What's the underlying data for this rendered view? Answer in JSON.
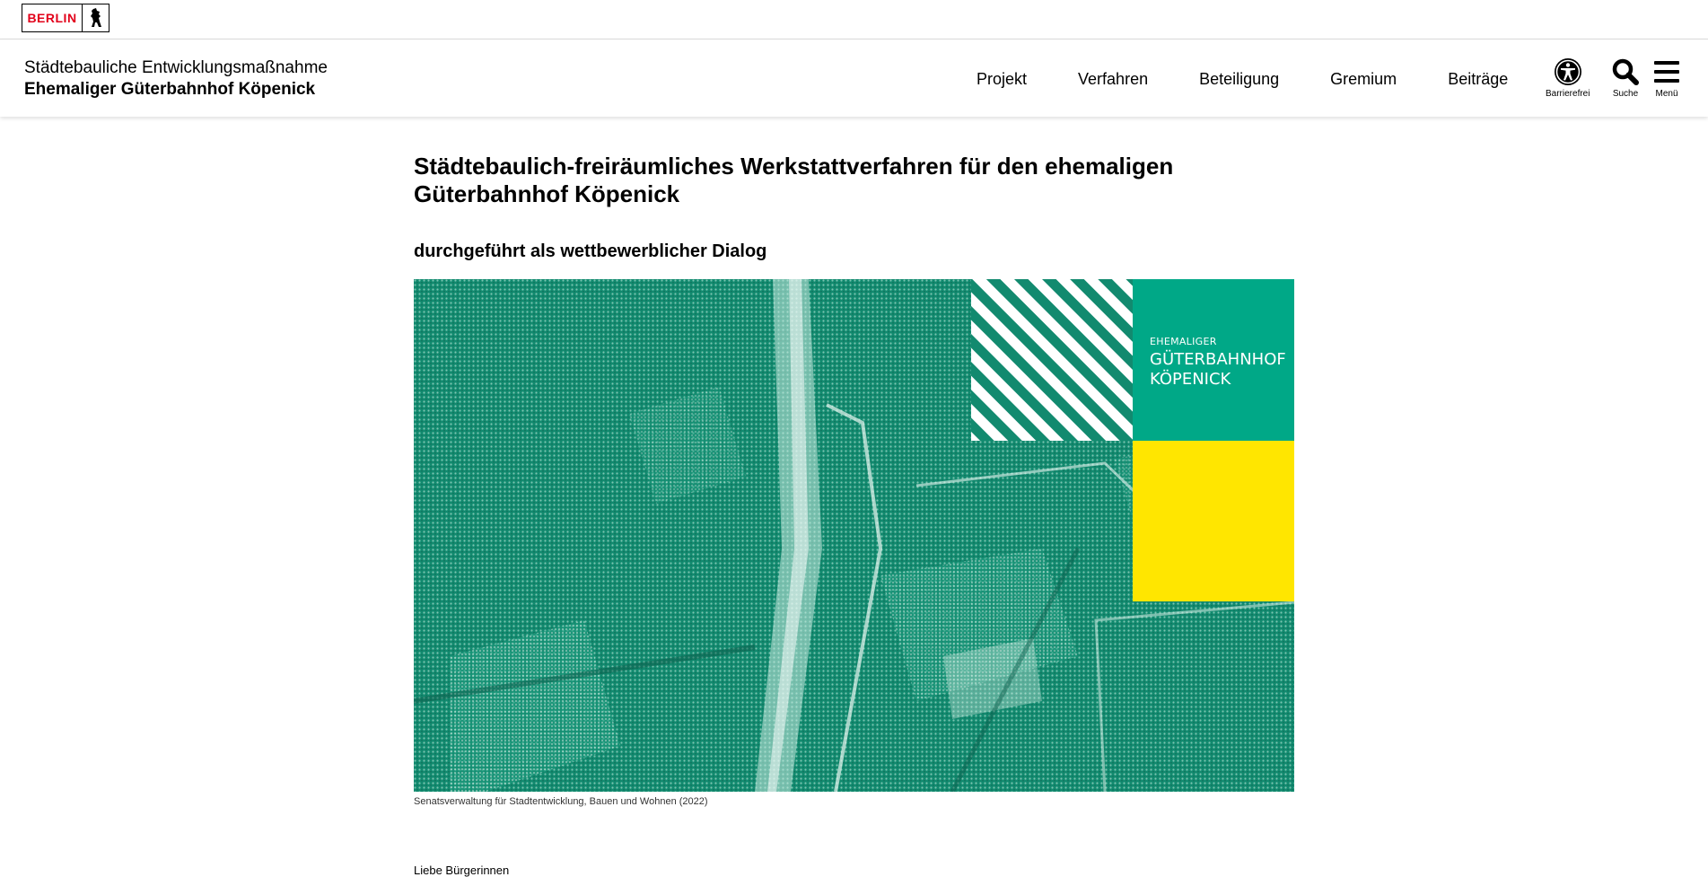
{
  "topbar": {
    "logo_word": "BERLIN",
    "logo_red": "#e2001a"
  },
  "header": {
    "title_line1": "Städtebauliche Entwicklungsmaßnahme",
    "title_line2": "Ehemaliger Güterbahnhof Köpenick"
  },
  "nav": {
    "items": [
      {
        "label": "Projekt"
      },
      {
        "label": "Verfahren"
      },
      {
        "label": "Beteiligung"
      },
      {
        "label": "Gremium"
      },
      {
        "label": "Beiträge"
      }
    ]
  },
  "tools": {
    "accessibility_label": "Barrierefrei",
    "search_label": "Suche",
    "menu_label": "Menü"
  },
  "main": {
    "heading": "Städtebaulich-freiräumliches Werkstattverfahren für den ehemaligen Güterbahnhof Köpenick",
    "subheading": "durchgeführt als wettbewerblicher Dialog",
    "image": {
      "logo_small": "EHEMALIGER",
      "logo_big1": "GÜTERBAHNHOF",
      "logo_big2": "KÖPENICK",
      "colors": {
        "aerial_green": "#128a6f",
        "brand_green": "#00a887",
        "brand_yellow": "#ffe600"
      }
    },
    "caption": "Senatsverwaltung für Stadtentwicklung, Bauen und Wohnen (2022)",
    "below_text": "Liebe Bürgerinnen"
  }
}
